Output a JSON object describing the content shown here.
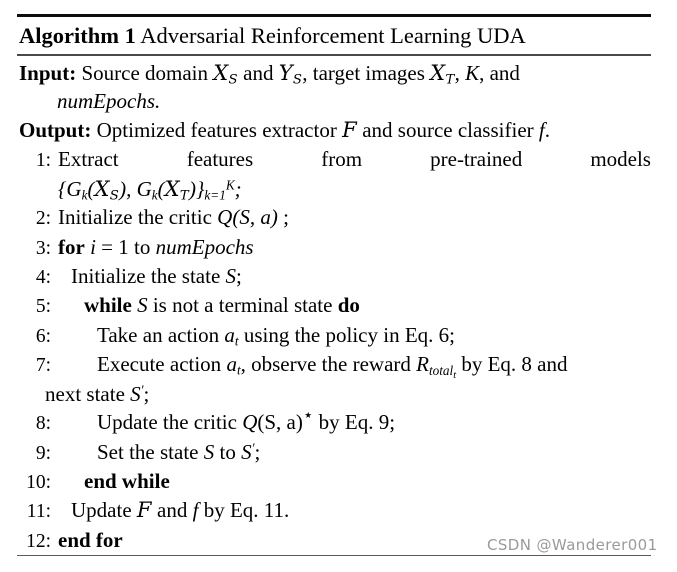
{
  "algorithm": {
    "label": "Algorithm 1",
    "title": "Adversarial Reinforcement Learning UDA",
    "input": {
      "label": "Input:",
      "text_a": "Source domain ",
      "sym_xs": "X",
      "sub_s": "S",
      "text_b": " and ",
      "sym_ys": "Y",
      "sub_s2": "S",
      "text_c": ", target images ",
      "sym_xt": "X",
      "sub_t": "T",
      "text_d": ", ",
      "sym_k": "K",
      "text_e": ", and",
      "continuation": "numEpochs."
    },
    "output": {
      "label": "Output:",
      "text_a": "Optimized features extractor ",
      "sym_f_cal": "F",
      "text_b": " and source classifier ",
      "sym_f": "f",
      "text_c": "."
    },
    "steps": [
      {
        "num": "1:",
        "indent": 0,
        "justified_words": [
          "Extract",
          "features",
          "from",
          "pre-trained",
          "models"
        ],
        "continuation_math": "{G_k(X_S), G_k(X_T)}_{k=1}^{K};"
      },
      {
        "num": "2:",
        "indent": 0,
        "text_a": "Initialize the critic ",
        "math": "Q(S, a)",
        "text_b": " ;"
      },
      {
        "num": "3:",
        "indent": 0,
        "kw_a": "for",
        "math_i": "i",
        "eq": " = 1 ",
        "text_to": "to ",
        "math_epochs": "numEpochs"
      },
      {
        "num": "4:",
        "indent": 1,
        "text_a": "Initialize the state ",
        "math_s": "S",
        "text_b": ";"
      },
      {
        "num": "5:",
        "indent": 2,
        "kw_a": "while",
        "math_s": "S",
        "text_a": " is not a terminal state ",
        "kw_b": "do"
      },
      {
        "num": "6:",
        "indent": 3,
        "text_a": "Take an action ",
        "math_a": "a",
        "sub_t": "t",
        "text_b": " using the policy in Eq. 6;"
      },
      {
        "num": "7:",
        "indent": 3,
        "text_a": "Execute action ",
        "math_a": "a",
        "sub_t": "t",
        "text_b": ", observe the reward ",
        "math_r": "R",
        "sub_total": "total",
        "sub_t2": "t",
        "text_c": " by Eq. 8 and",
        "continuation_a": "next state ",
        "continuation_s": "S",
        "continuation_prime": "′",
        "continuation_b": ";"
      },
      {
        "num": "8:",
        "indent": 3,
        "text_a": "Update the critic ",
        "math_q": "Q",
        "text_paren": "(S, a)",
        "sup_star": "⋆",
        "text_b": " by Eq. 9;"
      },
      {
        "num": "9:",
        "indent": 3,
        "text_a": "Set the state ",
        "math_s": "S",
        "text_b": " to ",
        "math_s2": "S",
        "prime": "′",
        "text_c": ";"
      },
      {
        "num": "10:",
        "indent": 2,
        "kw_a": "end while"
      },
      {
        "num": "11:",
        "indent": 1,
        "text_a": "Update ",
        "sym_f_cal": "F",
        "text_b": " and ",
        "sym_f": "f",
        "text_c": " by Eq. 11."
      },
      {
        "num": "12:",
        "indent": 0,
        "kw_a": "end for"
      }
    ]
  },
  "watermark": {
    "text": "CSDN @Wanderer001",
    "color": "#9a9a9a"
  }
}
